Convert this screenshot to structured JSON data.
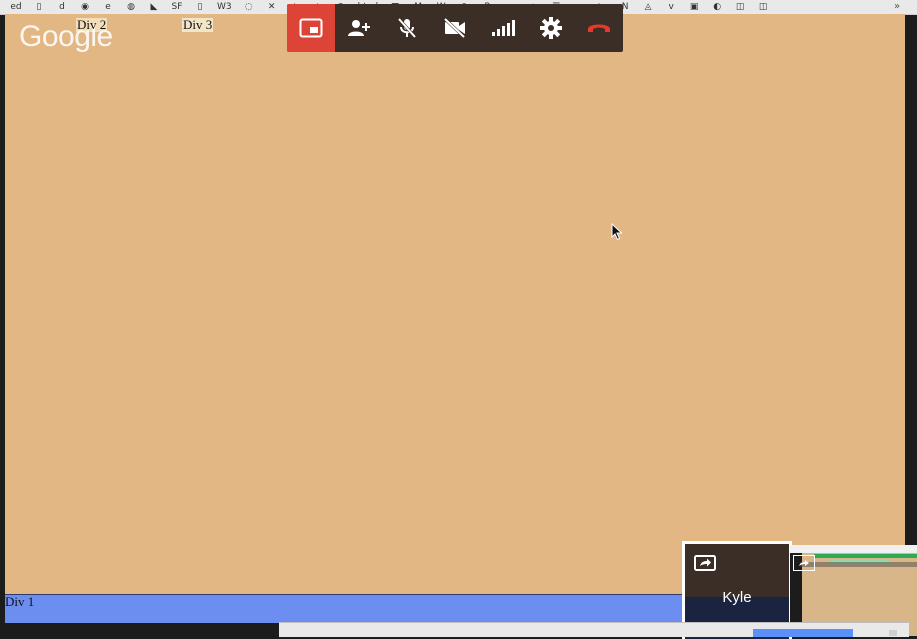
{
  "bookmarks": [
    "ed",
    "",
    "d",
    "",
    "e",
    "",
    "",
    "SF",
    "",
    "W3",
    "",
    "",
    "",
    "",
    "",
    "",
    "",
    "",
    "html",
    "",
    "",
    "W",
    "",
    "P",
    "",
    "",
    "",
    "N",
    "",
    "",
    "",
    "",
    "",
    "",
    ""
  ],
  "bookmarks_overflow": "»",
  "logo": "Google",
  "page": {
    "div1": "Div 1",
    "div2": "Div 2",
    "div3": "Div 3",
    "background_color": "#e2b783",
    "div1_color": "#6b8ef0"
  },
  "controls": [
    {
      "name": "present-screen-icon",
      "active": true
    },
    {
      "name": "add-person-icon",
      "active": false
    },
    {
      "name": "mic-off-icon",
      "active": false
    },
    {
      "name": "video-off-icon",
      "active": false
    },
    {
      "name": "signal-bars-icon",
      "active": false
    },
    {
      "name": "settings-gear-icon",
      "active": false
    },
    {
      "name": "hang-up-icon",
      "active": false
    }
  ],
  "participants": [
    {
      "name": "Kyle",
      "icon": "screen-share-icon"
    },
    {
      "name": "",
      "icon": "screen-share-icon"
    }
  ],
  "colors": {
    "control_bar": "#3b2e26",
    "control_active": "#db4437",
    "hangup": "#e5392c"
  }
}
